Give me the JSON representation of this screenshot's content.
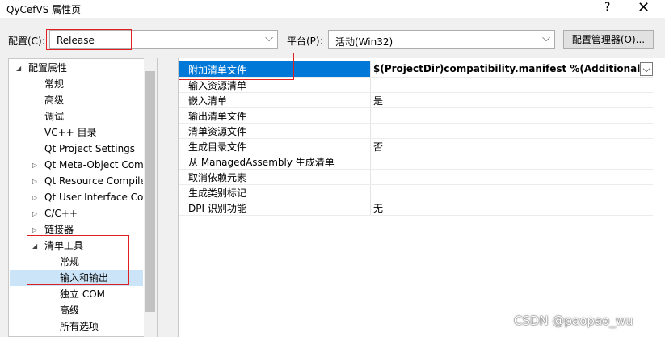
{
  "window": {
    "title": "QyCefVS 属性页",
    "help": "?",
    "close": "✕"
  },
  "config": {
    "label": "配置(C):",
    "value": "Release"
  },
  "platform": {
    "label": "平台(P):",
    "value": "活动(Win32)"
  },
  "config_manager_button": "配置管理器(O)...",
  "tree": {
    "root": "配置属性",
    "items": [
      {
        "label": "常规"
      },
      {
        "label": "高级"
      },
      {
        "label": "调试"
      },
      {
        "label": "VC++ 目录"
      },
      {
        "label": "Qt Project Settings"
      },
      {
        "label": "Qt Meta-Object Com"
      },
      {
        "label": "Qt Resource Compile"
      },
      {
        "label": "Qt User Interface Co"
      },
      {
        "label": "C/C++"
      },
      {
        "label": "链接器"
      },
      {
        "label": "清单工具"
      },
      {
        "label": "常规"
      },
      {
        "label": "输入和输出"
      },
      {
        "label": "独立 COM"
      },
      {
        "label": "高级"
      },
      {
        "label": "所有选项"
      }
    ]
  },
  "properties": [
    {
      "name": "附加清单文件",
      "value": "$(ProjectDir)compatibility.manifest %(AdditionalMan"
    },
    {
      "name": "输入资源清单",
      "value": ""
    },
    {
      "name": "嵌入清单",
      "value": "是"
    },
    {
      "name": "输出清单文件",
      "value": ""
    },
    {
      "name": "清单资源文件",
      "value": ""
    },
    {
      "name": "生成目录文件",
      "value": "否"
    },
    {
      "name": "从 ManagedAssembly 生成清单",
      "value": ""
    },
    {
      "name": "取消依赖元素",
      "value": ""
    },
    {
      "name": "生成类别标记",
      "value": ""
    },
    {
      "name": "DPI 识别功能",
      "value": "无"
    }
  ],
  "watermark": "CSDN @paopao_wu",
  "colors": {
    "selection": "#0078d7",
    "tree_selection": "#cce4f7",
    "highlight_box": "#e02020"
  }
}
